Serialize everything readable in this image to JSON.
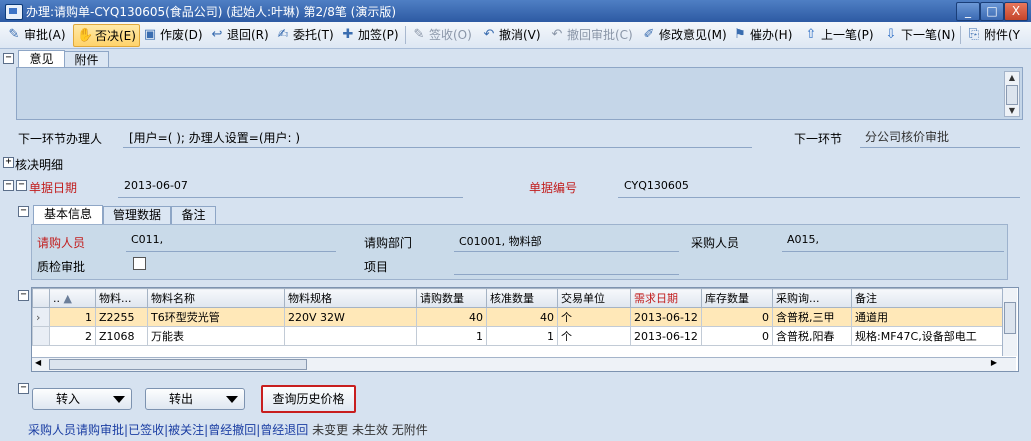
{
  "window": {
    "title": "办理:请购单-CYQ130605(食品公司) (起始人:叶琳) 第2/8笔 (演示版)",
    "min": "_",
    "max": "□",
    "close": "X"
  },
  "toolbar": {
    "approve": "审批(A)",
    "reject": "否决(E)",
    "void": "作废(D)",
    "return": "退回(R)",
    "delegate": "委托(T)",
    "add_sign": "加签(P)",
    "receive": "签收(O)",
    "undo": "撤消(V)",
    "undo_approval": "撤回审批(C)",
    "modify_opinion": "修改意见(M)",
    "urge": "催办(H)",
    "prev": "上一笔(P)",
    "next": "下一笔(N)",
    "attachment": "附件(Y"
  },
  "tabs": {
    "opinion": "意见",
    "attachment": "附件"
  },
  "routing": {
    "next_handler_label": "下一环节办理人",
    "handler_value": "[用户=(        );  办理人设置=(用户:          )",
    "next_step_label": "下一环节",
    "next_step_value": "分公司核价审批"
  },
  "approval_details_label": "核决明细",
  "doc": {
    "date_label": "单据日期",
    "date_value": "2013-06-07",
    "number_label": "单据编号",
    "number_value": "CYQ130605"
  },
  "info_tabs": {
    "basic": "基本信息",
    "mgmt": "管理数据",
    "remarks": "备注"
  },
  "basic": {
    "requester_label": "请购人员",
    "requester_value": "C011,",
    "dept_label": "请购部门",
    "dept_value": "C01001, 物料部",
    "buyer_label": "采购人员",
    "buyer_value": "A015,",
    "qc_label": "质检审批",
    "project_label": "项目"
  },
  "grid": {
    "columns": [
      "..",
      "物料...",
      "物料名称",
      "物料规格",
      "请购数量",
      "核准数量",
      "交易单位",
      "需求日期",
      "库存数量",
      "采购询...",
      "备注"
    ],
    "rows": [
      [
        "1",
        "Z2255",
        "T6环型荧光管",
        "220V 32W",
        "40",
        "40",
        "个",
        "2013-06-12",
        "0",
        "含普税,三甲",
        "通道用"
      ],
      [
        "2",
        "Z1068",
        "万能表",
        "",
        "1",
        "1",
        "个",
        "2013-06-12",
        "0",
        "含普税,阳春",
        "规格:MF47C,设备部电工"
      ]
    ]
  },
  "buttons": {
    "transfer_in": "转入",
    "transfer_out": "转出",
    "price_history": "查询历史价格"
  },
  "status": {
    "links": [
      "采购人员请购审批",
      "已签收",
      "被关注",
      "曾经撤回",
      "曾经退回"
    ],
    "plain": [
      "未变更",
      "未生效",
      "无附件"
    ]
  }
}
